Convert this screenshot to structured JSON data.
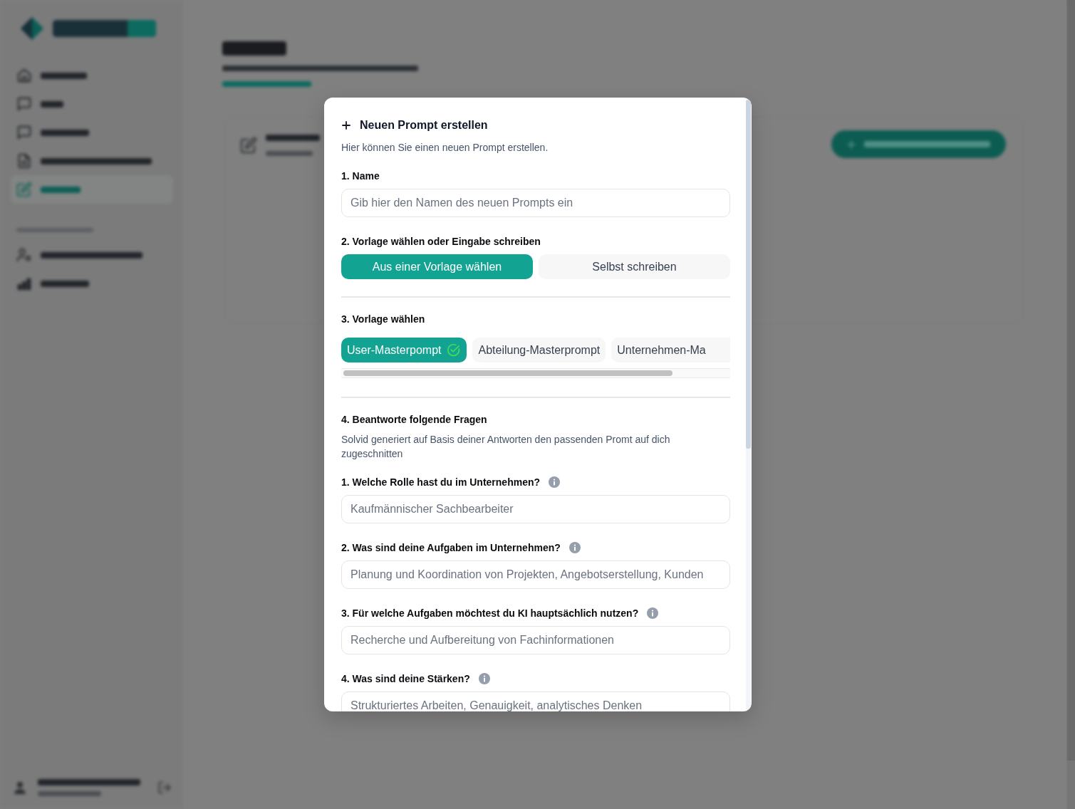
{
  "sidebar": {
    "items": [
      {
        "selected": false
      },
      {
        "selected": false
      },
      {
        "selected": false
      },
      {
        "selected": false
      },
      {
        "selected": true
      }
    ],
    "settings_items": [
      {
        "selected": false
      },
      {
        "selected": false
      }
    ]
  },
  "dialog": {
    "title": "Neuen Prompt erstellen",
    "description": "Hier können Sie einen neuen Prompt erstellen.",
    "name_section": {
      "label": "1. Name",
      "placeholder": "Gib hier den Namen des neuen Prompts ein"
    },
    "mode_section": {
      "label": "2. Vorlage wählen oder Eingabe schreiben",
      "options": [
        {
          "label": "Aus einer Vorlage wählen",
          "selected": true
        },
        {
          "label": "Selbst schreiben",
          "selected": false
        }
      ]
    },
    "template_section": {
      "label": "3. Vorlage wählen",
      "templates": [
        {
          "label": "User-Masterpompt",
          "selected": true
        },
        {
          "label": "Abteilung-Masterprompt",
          "selected": false
        },
        {
          "label": "Unternehmen-Ma",
          "selected": false
        }
      ]
    },
    "questions_section": {
      "label": "4. Beantworte folgende Fragen",
      "description": "Solvid generiert auf Basis deiner Antworten den passenden Promt auf dich zugeschnitten",
      "questions": [
        {
          "label": "1. Welche Rolle hast du im Unternehmen?",
          "placeholder": "Kaufmännischer Sachbearbeiter"
        },
        {
          "label": "2. Was sind deine Aufgaben im Unternehmen?",
          "placeholder": "Planung und Koordination von Projekten, Angebotserstellung, Kunden"
        },
        {
          "label": "3. Für welche Aufgaben möchtest du KI hauptsächlich nutzen?",
          "placeholder": "Recherche und Aufbereitung von Fachinformationen"
        },
        {
          "label": "4. Was sind deine Stärken?",
          "placeholder": "Strukturiertes Arbeiten, Genauigkeit, analytisches Denken"
        }
      ]
    }
  }
}
